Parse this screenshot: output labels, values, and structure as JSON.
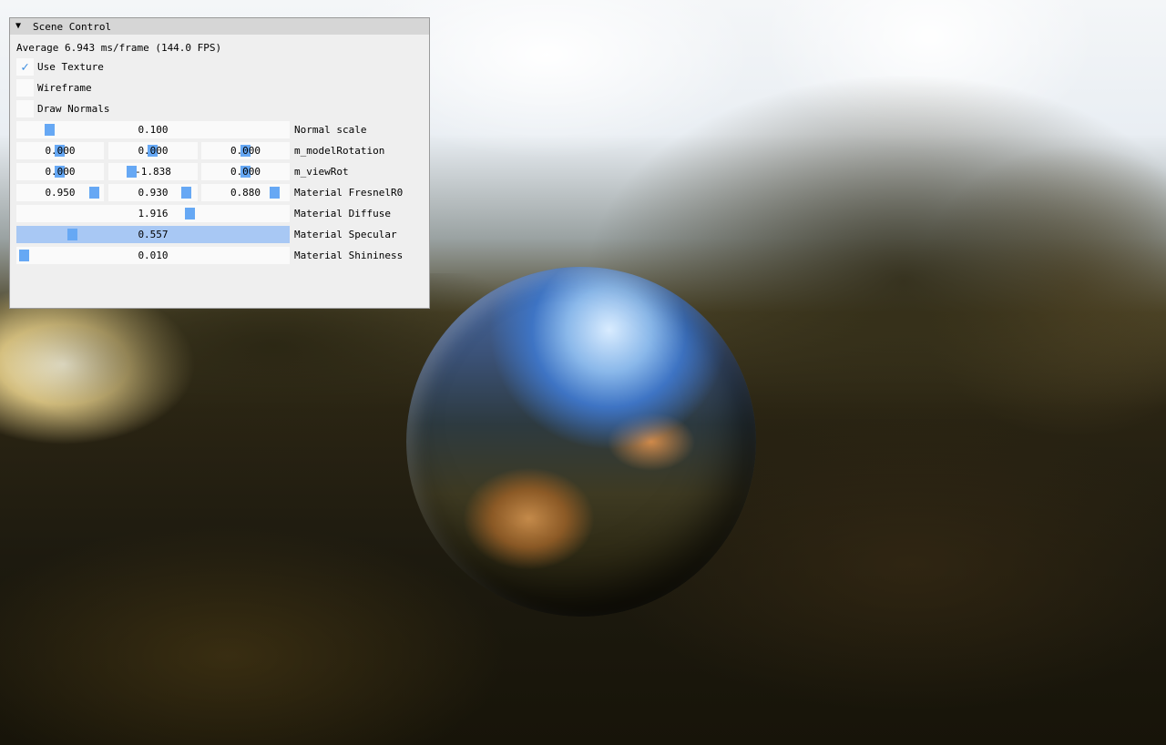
{
  "window": {
    "title": "Scene Control",
    "stats": "Average 6.943 ms/frame (144.0 FPS)"
  },
  "checkboxes": [
    {
      "label": "Use Texture",
      "checked": true
    },
    {
      "label": "Wireframe",
      "checked": false
    },
    {
      "label": "Draw Normals",
      "checked": false
    }
  ],
  "controls": {
    "normal_scale": {
      "label": "Normal scale",
      "value": "0.100"
    },
    "model_rotation": {
      "label": "m_modelRotation",
      "values": [
        "0.000",
        "0.000",
        "0.000"
      ]
    },
    "view_rot": {
      "label": "m_viewRot",
      "values": [
        "0.000",
        "-1.838",
        "0.000"
      ]
    },
    "fresnel": {
      "label": "Material FresnelR0",
      "values": [
        "0.950",
        "0.930",
        "0.880"
      ]
    },
    "diffuse": {
      "label": "Material Diffuse",
      "value": "1.916"
    },
    "specular": {
      "label": "Material Specular",
      "value": "0.557"
    },
    "shininess": {
      "label": "Material Shininess",
      "value": "0.010"
    }
  },
  "colors": {
    "slider_grab": "#66a8f4",
    "slider_active_bg": "#a8c8f4",
    "checkmark": "#3b8de0",
    "panel_bg": "#efefef",
    "title_bg": "#d6d6d6"
  },
  "icons": {
    "collapse": "triangle-down-icon",
    "check": "checkmark-icon"
  }
}
